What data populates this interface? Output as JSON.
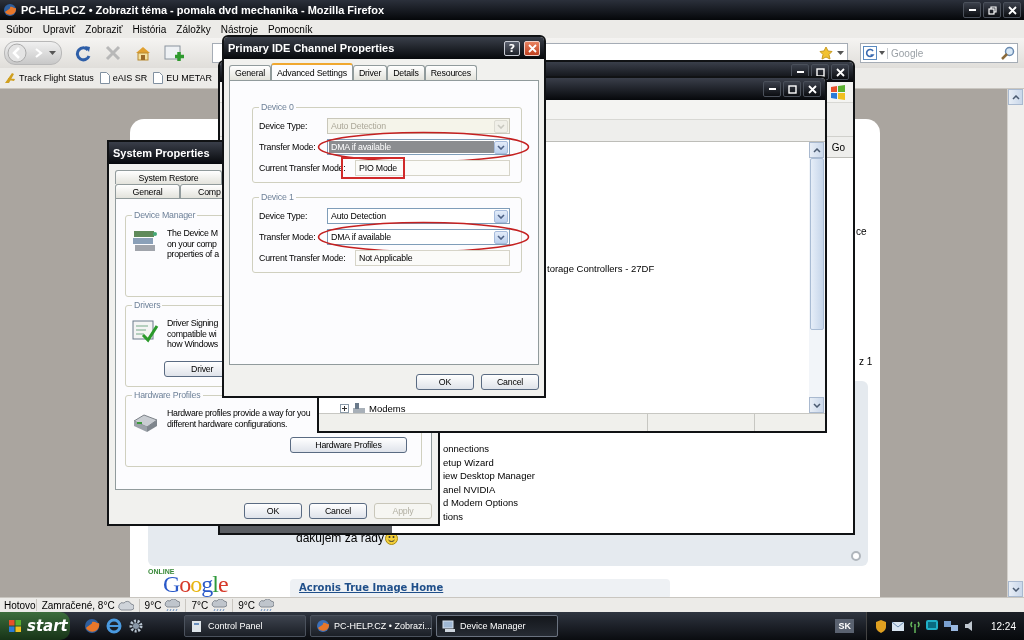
{
  "browser": {
    "title": "PC-HELP.CZ • Zobrazit téma - pomala dvd mechanika - Mozilla Firefox",
    "menu": [
      "Súbor",
      "Upraviť",
      "Zobraziť",
      "História",
      "Záložky",
      "Nástroje",
      "Pomocník"
    ],
    "search": {
      "placeholder": "Google"
    },
    "bookmarks": [
      "Track Flight Status",
      "eAIS SR",
      "EU METAR"
    ],
    "status": "Hotovo",
    "weather": [
      {
        "text": "Zamračené, 8°C",
        "kind": "cloudy"
      },
      {
        "text": "9°C",
        "kind": "rain"
      },
      {
        "text": "7°C",
        "kind": "rain"
      },
      {
        "text": "9°C",
        "kind": "rain"
      }
    ]
  },
  "page": {
    "fragments": [
      "ce",
      "z 1"
    ],
    "post": "dakujem za rady",
    "online_label": "ONLINE",
    "ad_logo": "Google",
    "ad_link": "Acronis True Image Home"
  },
  "control_panel": {
    "go_button": "Go",
    "items": [
      "onnections",
      "etup Wizard",
      "iew Desktop Manager",
      "anel NVIDIA",
      "d Modem Options",
      "tions"
    ]
  },
  "system_properties": {
    "title": "System Properties",
    "tab_rows": [
      [
        {
          "label": "System Restore",
          "selected": false
        }
      ],
      [
        {
          "label": "General",
          "selected": false
        },
        {
          "label": "Comp",
          "selected": false
        }
      ]
    ],
    "groups": [
      {
        "title": "Device Manager",
        "kind": "devices",
        "lines": [
          "The Device M",
          "on your comp",
          "properties of a"
        ]
      },
      {
        "title": "Drivers",
        "kind": "drivers",
        "lines": [
          "Driver Signing",
          "compatible wi",
          "how Windows"
        ],
        "button": "Driver"
      },
      {
        "title": "Hardware Profiles",
        "kind": "profiles",
        "lines": [
          "Hardware profiles provide a way for you",
          "different hardware configurations."
        ],
        "button": "Hardware Profiles"
      }
    ],
    "buttons": [
      {
        "label": "OK",
        "disabled": false
      },
      {
        "label": "Cancel",
        "disabled": false
      },
      {
        "label": "Apply",
        "disabled": true
      }
    ]
  },
  "device_manager": {
    "tree": [
      {
        "label": "torage Controllers - 27DF"
      },
      {
        "label": "Modems",
        "expanded": false
      }
    ]
  },
  "ide_dialog": {
    "title": "Primary IDE Channel Properties",
    "help_button": "?",
    "tabs": [
      {
        "label": "General",
        "selected": false
      },
      {
        "label": "Advanced Settings",
        "selected": true
      },
      {
        "label": "Driver",
        "selected": false
      },
      {
        "label": "Details",
        "selected": false
      },
      {
        "label": "Resources",
        "selected": false
      }
    ],
    "groups": [
      {
        "title": "Device 0",
        "fields": [
          {
            "label": "Device Type:",
            "kind": "combo",
            "value": "Auto Detection",
            "disabled": true,
            "highlighted": false
          },
          {
            "label": "Transfer Mode:",
            "kind": "combo",
            "value": "DMA if available",
            "disabled": false,
            "highlighted": true,
            "circled": true
          },
          {
            "label": "Current Transfer Mode:",
            "kind": "text",
            "value": "PIO Mode",
            "boxed": true
          }
        ]
      },
      {
        "title": "Device 1",
        "fields": [
          {
            "label": "Device Type:",
            "kind": "combo",
            "value": "Auto Detection",
            "disabled": false,
            "highlighted": false
          },
          {
            "label": "Transfer Mode:",
            "kind": "combo",
            "value": "DMA if available",
            "disabled": false,
            "highlighted": false,
            "circled": true
          },
          {
            "label": "Current Transfer Mode:",
            "kind": "text",
            "value": "Not Applicable"
          }
        ]
      }
    ],
    "buttons": [
      "OK",
      "Cancel"
    ]
  },
  "taskbar": {
    "start": "start",
    "tasks": [
      {
        "label": "Control Panel",
        "selected": false,
        "kind": "panel"
      },
      {
        "label": "PC-HELP.CZ • Zobrazi...",
        "selected": false,
        "kind": "browser"
      },
      {
        "label": "Device Manager",
        "selected": true,
        "kind": "devices"
      }
    ],
    "language": "SK",
    "clock": "12:24"
  }
}
